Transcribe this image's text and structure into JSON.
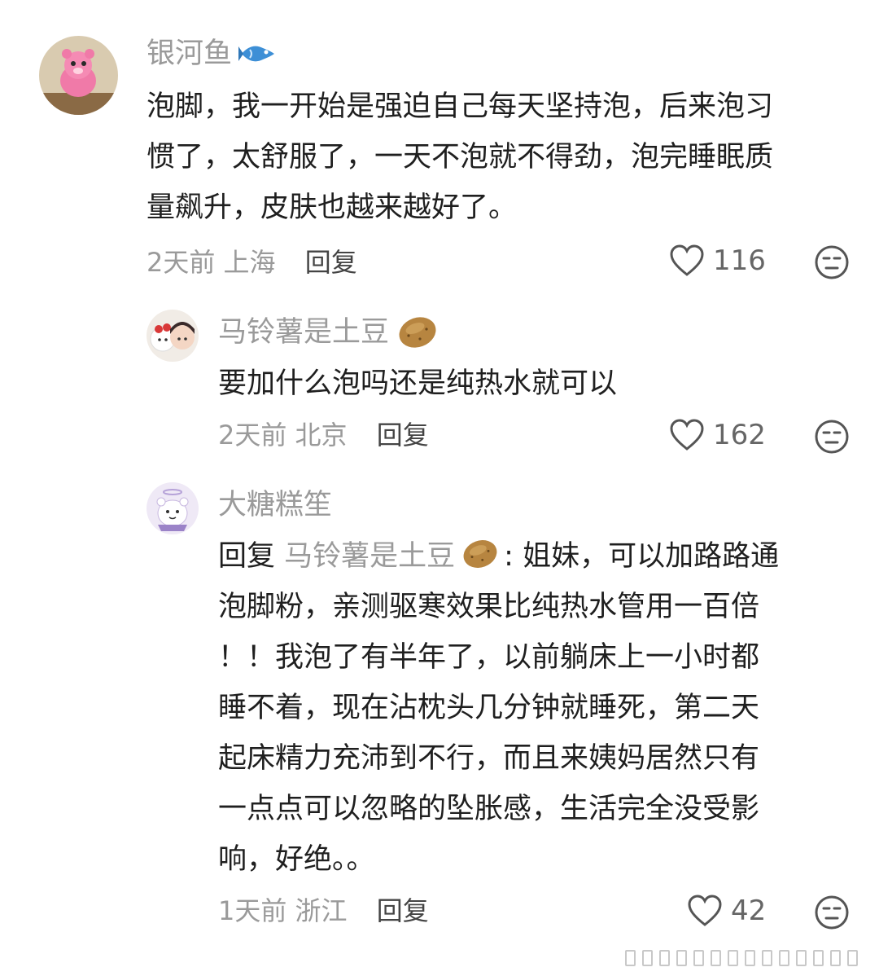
{
  "comments": [
    {
      "username": "银河鱼",
      "username_emoji": "fish-icon",
      "lines": [
        "泡脚，我一开始是强迫自己每天坚持泡，后来泡习",
        "惯了，太舒服了，一天不泡就不得劲，泡完睡眠质",
        "量飙升，皮肤也越来越好了。"
      ],
      "time": "2天前",
      "location": "上海",
      "reply_label": "回复",
      "likes": "116"
    },
    {
      "username": "马铃薯是土豆",
      "username_emoji": "potato-icon",
      "lines": [
        "要加什么泡吗还是纯热水就可以"
      ],
      "time": "2天前",
      "location": "北京",
      "reply_label": "回复",
      "likes": "162"
    },
    {
      "username": "大糖糕笙",
      "reply_prefix": "回复",
      "reply_to": "马铃薯是土豆",
      "reply_to_emoji": "potato-icon",
      "first_line_rest": ": 姐妹，可以加路路通",
      "lines": [
        "泡脚粉，亲测驱寒效果比纯热水管用一百倍",
        "！！我泡了有半年了，以前躺床上一小时都",
        "睡不着，现在沾枕头几分钟就睡死，第二天",
        "起床精力充沛到不行，而且来姨妈居然只有",
        "一点点可以忽略的坠胀感，生活完全没受影",
        "响，好绝。。"
      ],
      "time": "1天前",
      "location": "浙江",
      "reply_label": "回复",
      "likes": "42"
    }
  ],
  "colors": {
    "meta_gray": "#9a9a9a",
    "text_dark": "#1f1f1f",
    "background": "#ffffff"
  }
}
